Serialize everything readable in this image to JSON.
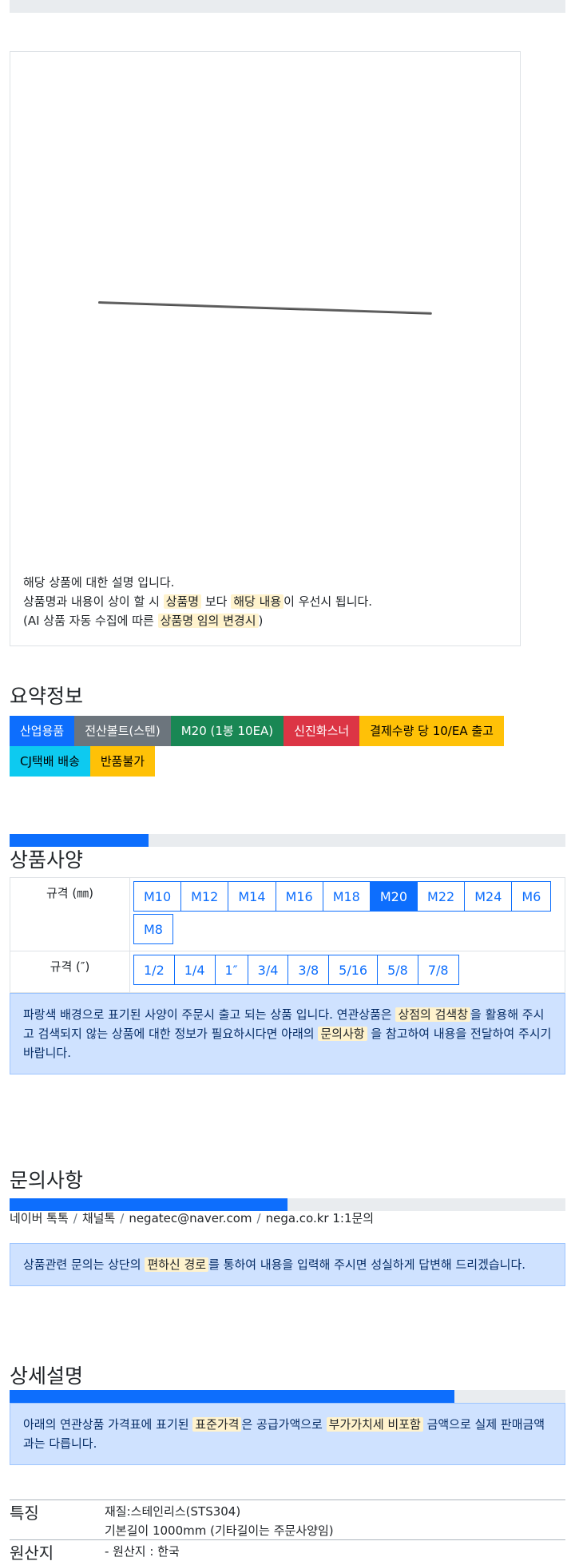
{
  "product": {
    "description_lines": {
      "l1": "해당 상품에 대한 설명 입니다.",
      "l2a": "상품명과 내용이 상이 할 시 ",
      "l2b": "상품명",
      "l2c": " 보다 ",
      "l2d": "해당 내용",
      "l2e": "이 우선시 됩니다.",
      "l3a": "(AI 상품 자동 수집에 따른 ",
      "l3b": "상품명 임의 변경시",
      "l3c": ")"
    }
  },
  "summary": {
    "title": "요약정보",
    "badges": [
      {
        "label": "산업용품",
        "color": "#0d6efd",
        "text_color": "#ffffff"
      },
      {
        "label": "전산볼트(스텐)",
        "color": "#6c757d",
        "text_color": "#ffffff"
      },
      {
        "label": "M20 (1봉 10EA)",
        "color": "#198754",
        "text_color": "#ffffff"
      },
      {
        "label": "신진화스너",
        "color": "#dc3545",
        "text_color": "#ffffff"
      },
      {
        "label": "결제수량 당 10/EA 출고",
        "color": "#ffc107",
        "text_color": "#000000"
      },
      {
        "label": "CJ택배 배송",
        "color": "#0dcaf0",
        "text_color": "#000000"
      },
      {
        "label": "반품불가",
        "color": "#ffc107",
        "text_color": "#000000"
      }
    ]
  },
  "spec": {
    "title": "상품사양",
    "progress": 0.25,
    "rows": [
      {
        "label": "규격 (㎜)",
        "options": [
          "M10",
          "M12",
          "M14",
          "M16",
          "M18",
          "M20",
          "M22",
          "M24",
          "M6",
          "M8"
        ],
        "selected": "M20"
      },
      {
        "label": "규격 (″)",
        "options": [
          "1/2",
          "1/4",
          "1″",
          "3/4",
          "3/8",
          "5/16",
          "5/8",
          "7/8"
        ],
        "selected": ""
      }
    ],
    "notice": {
      "a": "파랑색 배경으로 표기된 사양이 주문시 출고 되는 상품 입니다. 연관상품은 ",
      "b": "상점의 검색창",
      "c": "을 활용해 주시고 검색되지 않는 상품에 대한 정보가 필요하시다면 아래의 ",
      "d": "문의사항",
      "e": " 을 참고하여 내용을 전달하여 주시기 바랍니다."
    }
  },
  "inquiry": {
    "title": "문의사항",
    "progress": 0.5,
    "links": [
      "네이버 톡톡",
      "채널톡",
      "negatec@naver.com",
      "nega.co.kr 1:1문의"
    ],
    "separator": "/",
    "notice": {
      "a": "상품관련 문의는 상단의 ",
      "b": "편하신 경로",
      "c": "를 통하여 내용을 입력해 주시면 성실하게 답변해 드리겠습니다."
    }
  },
  "detail": {
    "title": "상세설명",
    "progress": 0.8,
    "notice": {
      "a": "아래의 연관상품 가격표에 표기된 ",
      "b": "표준가격",
      "c": "은 공급가액으로 ",
      "d": "부가가치세 비포함",
      "e": " 금액으로 실제 판매금액과는 다릅니다."
    },
    "features": {
      "label": "특징",
      "lines": [
        "재질:스테인리스(STS304)",
        "기본길이 1000mm (기타길이는 주문사양임)"
      ]
    },
    "origin": {
      "label": "원산지",
      "value": "- 원산지 : 한국"
    }
  }
}
